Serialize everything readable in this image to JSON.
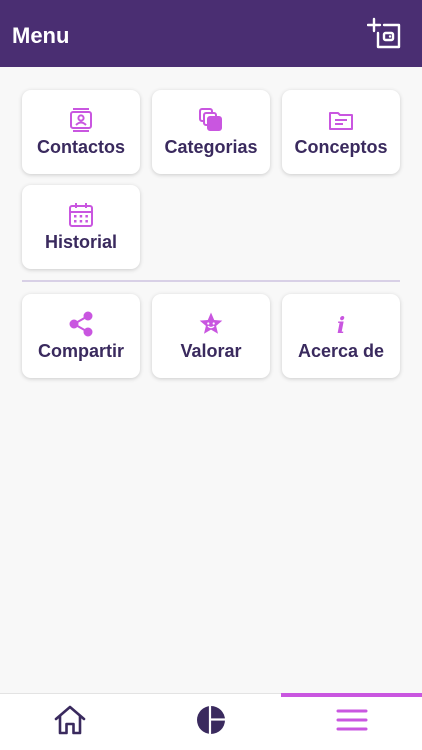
{
  "header": {
    "title": "Menu",
    "action_icon": "add-card-icon"
  },
  "menu": {
    "primary_items": [
      {
        "label": "Contactos",
        "icon": "contacts-icon"
      },
      {
        "label": "Categorias",
        "icon": "categories-icon"
      },
      {
        "label": "Conceptos",
        "icon": "folder-icon"
      },
      {
        "label": "Historial",
        "icon": "calendar-icon"
      }
    ],
    "secondary_items": [
      {
        "label": "Compartir",
        "icon": "share-icon"
      },
      {
        "label": "Valorar",
        "icon": "star-icon"
      },
      {
        "label": "Acerca de",
        "icon": "info-icon"
      }
    ]
  },
  "tabbar": {
    "tabs": [
      {
        "icon": "home-icon",
        "active": false
      },
      {
        "icon": "pie-chart-icon",
        "active": false
      },
      {
        "icon": "menu-icon",
        "active": true
      }
    ]
  },
  "colors": {
    "header_bg": "#4a2e72",
    "accent": "#c956e0",
    "label": "#3a2a5e",
    "tab_icon": "#3a2a5e"
  }
}
